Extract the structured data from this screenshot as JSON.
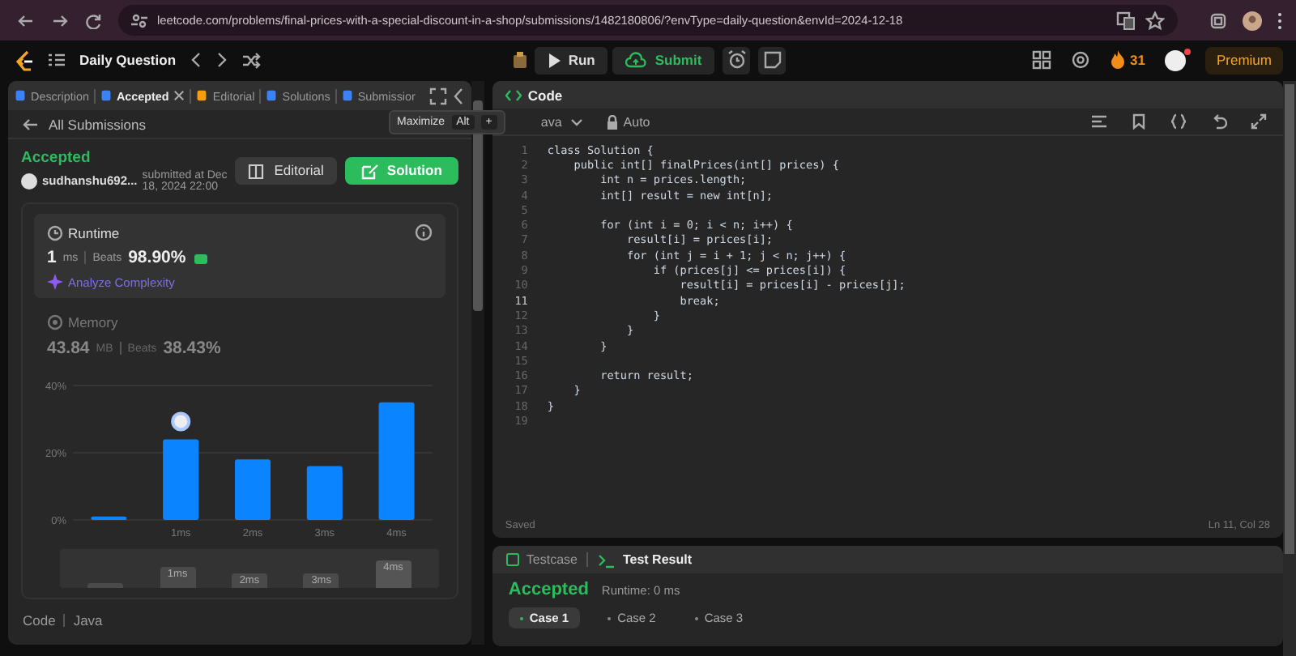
{
  "browser": {
    "url": "leetcode.com/problems/final-prices-with-a-special-discount-in-a-shop/submissions/1482180806/?envType=daily-question&envId=2024-12-18"
  },
  "header": {
    "title": "Daily Question",
    "run": "Run",
    "submit": "Submit",
    "streak": "31",
    "premium": "Premium"
  },
  "left_panel": {
    "tabs": [
      {
        "label": "Description",
        "selected": false,
        "closable": false,
        "color": "#3b82f6"
      },
      {
        "label": "Accepted",
        "selected": true,
        "closable": true,
        "color": "#3b82f6"
      },
      {
        "label": "Editorial",
        "selected": false,
        "closable": false,
        "color": "#f59e0b"
      },
      {
        "label": "Solutions",
        "selected": false,
        "closable": false,
        "color": "#3b82f6"
      },
      {
        "label": "Submissior",
        "selected": false,
        "closable": false,
        "color": "#3b82f6"
      }
    ],
    "tooltip": {
      "label": "Maximize",
      "keys": [
        "Alt",
        "+"
      ]
    },
    "back_link": "All Submissions",
    "status": "Accepted",
    "user": "sudhanshu692...",
    "submitted": "submitted at Dec 18, 2024 22:00",
    "buttons": [
      {
        "label": "Editorial",
        "kind": "secondary"
      },
      {
        "label": "Solution",
        "kind": "primary"
      }
    ],
    "runtime": {
      "title": "Runtime",
      "value": "1",
      "unit": "ms",
      "beats_label": "Beats",
      "beats": "98.90%",
      "analyze": "Analyze Complexity"
    },
    "memory": {
      "title": "Memory",
      "value": "43.84",
      "unit": "MB",
      "beats_label": "Beats",
      "beats": "38.43%"
    },
    "chart_data": {
      "type": "bar",
      "categories": [
        null,
        "1ms",
        "2ms",
        "3ms",
        "4ms"
      ],
      "values": [
        1,
        24,
        18,
        16,
        35
      ],
      "ylim": [
        0,
        40
      ],
      "yticks": [
        {
          "value": 0,
          "label": "0%"
        },
        {
          "value": 20,
          "label": "20%"
        },
        {
          "value": 40,
          "label": "40%"
        }
      ]
    },
    "navigator_labels": [
      "1ms",
      "2ms",
      "3ms",
      "4ms"
    ],
    "footer": [
      "Code",
      "Java"
    ]
  },
  "editor": {
    "title": "Code",
    "language": "ava",
    "mode": "Auto",
    "lines": [
      {
        "n": "1",
        "text": "class Solution {",
        "current": false
      },
      {
        "n": "2",
        "text": "    public int[] finalPrices(int[] prices) {",
        "current": false
      },
      {
        "n": "3",
        "text": "        int n = prices.length;",
        "current": false
      },
      {
        "n": "4",
        "text": "        int[] result = new int[n];",
        "current": false
      },
      {
        "n": "5",
        "current": false
      },
      {
        "n": "6",
        "text": "        for (int i = 0; i < n; i++) {",
        "current": false
      },
      {
        "n": "7",
        "text": "            result[i] = prices[i];",
        "current": false
      },
      {
        "n": "8",
        "text": "            for (int j = i + 1; j < n; j++) {",
        "current": false
      },
      {
        "n": "9",
        "text": "                if (prices[j] <= prices[i]) {",
        "current": false
      },
      {
        "n": "10",
        "text": "                    result[i] = prices[i] - prices[j];",
        "current": false
      },
      {
        "n": "11",
        "text": "                    break;",
        "current": true
      },
      {
        "n": "12",
        "text": "                }",
        "current": false
      },
      {
        "n": "13",
        "text": "            }",
        "current": false
      },
      {
        "n": "14",
        "text": "        }",
        "current": false
      },
      {
        "n": "15",
        "current": false
      },
      {
        "n": "16",
        "text": "        return result;",
        "current": false
      },
      {
        "n": "17",
        "text": "    }",
        "current": false
      },
      {
        "n": "18",
        "text": "}",
        "current": false
      },
      {
        "n": "19",
        "current": false
      }
    ],
    "saved": "Saved",
    "cursor": "Ln 11, Col 28"
  },
  "test_panel": {
    "tabs": [
      {
        "label": "Testcase",
        "selected": false
      },
      {
        "label": "Test Result",
        "selected": true
      }
    ],
    "status": "Accepted",
    "runtime": "Runtime: 0 ms",
    "cases": [
      {
        "label": "Case 1",
        "selected": true
      },
      {
        "label": "Case 2",
        "selected": false
      },
      {
        "label": "Case 3",
        "selected": false
      }
    ]
  }
}
